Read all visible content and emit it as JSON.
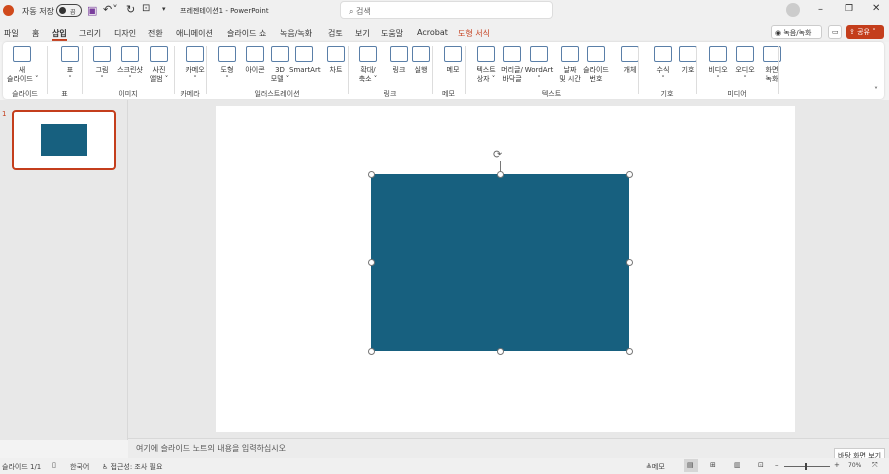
{
  "titlebar": {
    "autosave_label": "자동 저장",
    "autosave_state": "끔",
    "doc_title": "프레젠테이션1 - PowerPoint",
    "search_placeholder": "검색"
  },
  "tabs": [
    "파일",
    "홈",
    "삽입",
    "그리기",
    "디자인",
    "전환",
    "애니메이션",
    "슬라이드 쇼",
    "녹음/녹화",
    "검토",
    "보기",
    "도움말",
    "Acrobat",
    "도형 서식"
  ],
  "active_tab": "삽입",
  "right_buttons": {
    "record": "녹음/녹화",
    "share": "공유"
  },
  "ribbon": {
    "items": [
      {
        "label": "새\n슬라이드 ˅",
        "icon": "new-slide-icon"
      },
      {
        "label": "표\n˅",
        "icon": "table-icon"
      },
      {
        "label": "그림\n˅",
        "icon": "picture-icon"
      },
      {
        "label": "스크린샷\n˅",
        "icon": "screenshot-icon"
      },
      {
        "label": "사진\n앨범 ˅",
        "icon": "photo-album-icon"
      },
      {
        "label": "카메오\n˅",
        "icon": "cameo-icon"
      },
      {
        "label": "도형\n˅",
        "icon": "shapes-icon"
      },
      {
        "label": "아이콘",
        "icon": "icons-icon"
      },
      {
        "label": "3D\n모델 ˅",
        "icon": "3d-model-icon"
      },
      {
        "label": "SmartArt",
        "icon": "smartart-icon"
      },
      {
        "label": "차트",
        "icon": "chart-icon"
      },
      {
        "label": "확대/\n축소 ˅",
        "icon": "zoom-icon"
      },
      {
        "label": "링크",
        "icon": "link-icon"
      },
      {
        "label": "실행",
        "icon": "action-icon"
      },
      {
        "label": "메모",
        "icon": "comment-icon"
      },
      {
        "label": "텍스트\n상자 ˅",
        "icon": "textbox-icon"
      },
      {
        "label": "머리글/\n바닥글",
        "icon": "header-footer-icon"
      },
      {
        "label": "WordArt\n˅",
        "icon": "wordart-icon"
      },
      {
        "label": "날짜\n및 시간",
        "icon": "date-time-icon"
      },
      {
        "label": "슬라이드\n번호",
        "icon": "slide-number-icon"
      },
      {
        "label": "개체",
        "icon": "object-icon"
      },
      {
        "label": "수식\n˅",
        "icon": "equation-icon"
      },
      {
        "label": "기호",
        "icon": "symbol-icon"
      },
      {
        "label": "비디오\n˅",
        "icon": "video-icon"
      },
      {
        "label": "오디오\n˅",
        "icon": "audio-icon"
      },
      {
        "label": "화면\n녹화",
        "icon": "screen-recording-icon"
      }
    ],
    "groups": [
      "슬라이드",
      "표",
      "이미지",
      "카메라",
      "일러스트레이션",
      "링크",
      "메모",
      "텍스트",
      "기호",
      "미디어"
    ]
  },
  "thumbnail_number": "1",
  "shape_color": "#17607f",
  "notes_placeholder": "여기에 슬라이드 노트의 내용을 입력하십시오",
  "status": {
    "slide": "슬라이드 1/1",
    "language": "한국어",
    "accessibility": "접근성: 조사 필요",
    "notes": "메모",
    "zoom": "70%",
    "tooltip": "바탕 화면 보기"
  }
}
